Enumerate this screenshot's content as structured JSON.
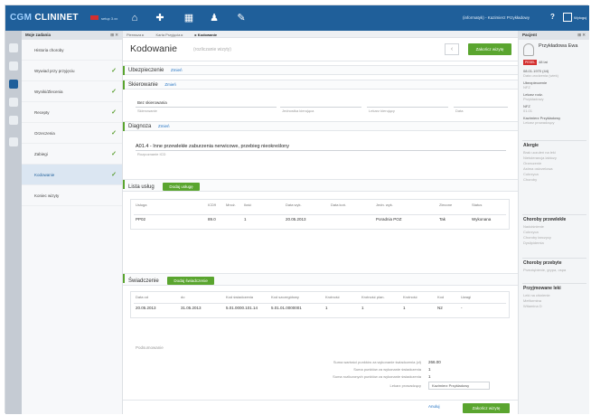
{
  "app": {
    "brand_a": "CGM",
    "brand_b": "CLININET",
    "brand_sub": "setup 3.xx"
  },
  "topbar": {
    "user": "(informatyk) - Kazimierz Przykładowy",
    "help": "?",
    "logout_label": "Wyloguj"
  },
  "sidebar": {
    "title": "Moje zadania",
    "controls": "⊞ ✕",
    "items": [
      {
        "label": "Historia choroby",
        "checked": false
      },
      {
        "label": "Wywiad przy przyjęciu",
        "checked": true
      },
      {
        "label": "Wyniki/Zlecenia",
        "checked": true
      },
      {
        "label": "Recepty",
        "checked": true
      },
      {
        "label": "Orzeczenia",
        "checked": true
      },
      {
        "label": "Zabiegi",
        "checked": true
      },
      {
        "label": "Kodowanie",
        "checked": true
      },
      {
        "label": "Koniec wizyty",
        "checked": false
      }
    ]
  },
  "breadcrumb": {
    "a": "Pierwsza ▸",
    "b": "Karta Przyjęcia ▸",
    "c": "▸ Kodowanie"
  },
  "page": {
    "title": "Kodowanie",
    "subtitle": "(rozliczanie wizyty)",
    "back": "‹",
    "save": "Zakończ wizytę"
  },
  "sections": {
    "ubezpieczenie": {
      "title": "Ubezpieczenie",
      "edit": "Zmień"
    },
    "skierowanie": {
      "title": "Skierowanie",
      "edit": "Zmień",
      "value": "Bez skierowania",
      "labels": [
        "Skierowanie",
        "Jednostka kierująca",
        "Lekarz kierujący",
        "Data"
      ]
    },
    "diagnoza": {
      "title": "Diagnoza",
      "edit": "Zmień",
      "value": "A01.4 - Inne przewlekłe zaburzenia nerwicowe, przebieg nieokreślony",
      "sub": "Rozpoznanie ICD"
    },
    "uslugi": {
      "title": "Lista usług",
      "add": "Dodaj usługę",
      "headers": [
        "Usługa",
        "ICD9",
        "Mnoż.",
        "Ilość",
        "Data wyk.",
        "Data koń.",
        "Jedn. wyk.",
        "Zlecone",
        "Status"
      ],
      "rows": [
        [
          "PP02",
          "89.0",
          "",
          "1",
          "20.05.2013",
          "",
          "Poradnia POZ",
          "Tak",
          "Wykonana"
        ]
      ]
    },
    "swiadczenie": {
      "title": "Świadczenie",
      "add": "Dodaj świadczenie",
      "headers": [
        "Data od",
        "do",
        "Kod świadczenia",
        "Kod szczegółowy",
        "Krotność",
        "Krotność plan.",
        "Krotność",
        "Kod",
        "Uwagi"
      ],
      "rows": [
        [
          "20.05.2013",
          "31.05.2013",
          "5.01.0000.101.14",
          "5.01.01.0000001",
          "1",
          "1",
          "1",
          "N2",
          "-"
        ]
      ]
    }
  },
  "summary": {
    "title": "Podsumowanie",
    "rows": [
      {
        "label": "Suma wartości punktów za wykonanie świadczenia (zł)",
        "value": "266.00"
      },
      {
        "label": "Suma punktów za wykonanie świadczenia",
        "value": "1"
      },
      {
        "label": "Suma rozliczonych punktów za wykonanie świadczenia",
        "value": "1"
      },
      {
        "label": "Lekarz prowadzący",
        "value": "Kazimierz Przykładowy"
      }
    ]
  },
  "footer": {
    "cancel": "Anuluj",
    "save": "Zakończ wizytę"
  },
  "rpanel": {
    "title": "Pacjent",
    "controls": "⊞ ✕",
    "patient_name": "Przykładowa Ewa",
    "badge": "PESEL",
    "age": "48 lat",
    "lines": [
      {
        "text": "08.01.1970 (44)",
        "muted": false
      },
      {
        "text": "Data urodzenia (wiek)",
        "muted": true
      },
      {
        "text": "Ubezpieczenie",
        "muted": false
      },
      {
        "text": "NFZ",
        "muted": true
      },
      {
        "text": "Lekarz rodz.",
        "muted": false
      },
      {
        "text": "Przykładowy",
        "muted": true
      },
      {
        "text": "NFZ",
        "muted": false
      },
      {
        "text": "01.01",
        "muted": true
      },
      {
        "text": "Kazimierz Przykładowy",
        "muted": false
      },
      {
        "text": "Lekarz prowadzący",
        "muted": true
      }
    ],
    "alerts_title": "Alergie",
    "alerts": [
      "Brak uczuleń na leki",
      "Nietolerancja laktozy",
      "Orzeczenie",
      "Astma oskrzelowa",
      "Cukrzyca",
      "Choroby"
    ],
    "chronic_title": "Choroby przewlekłe",
    "chronic": [
      "Nadciśnienie",
      "Cukrzyca",
      "Choroby tarczycy",
      "Dyslipidemia"
    ],
    "past_title": "Choroby przebyte",
    "past": [
      "Przeziębienie, grypa, ospa"
    ],
    "other_title": "Przyjmowane leki",
    "other": [
      "Leki na ciśnienie",
      "Metformina",
      "Witamina D"
    ]
  }
}
